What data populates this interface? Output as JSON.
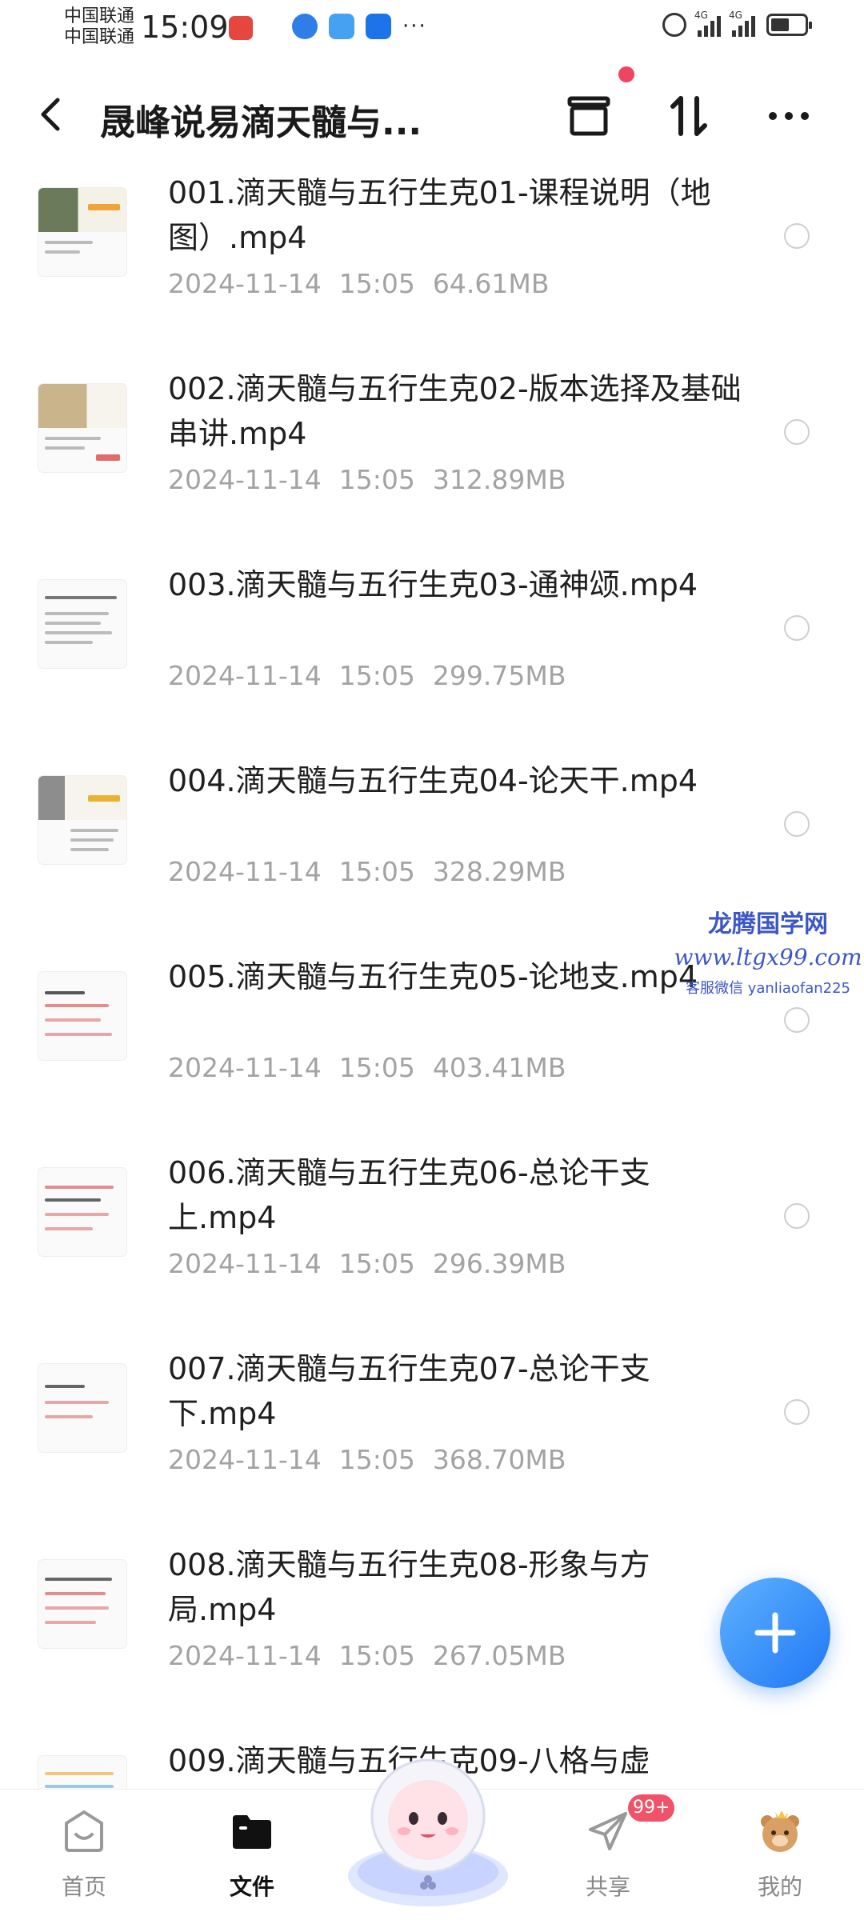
{
  "status_bar": {
    "carrier_1": "中国联通",
    "carrier_2": "中国联通",
    "time": "15:09",
    "more": "···",
    "network_1": "4G",
    "network_2": "4G"
  },
  "header": {
    "title": "晟峰说易滴天髓与...",
    "icons": [
      "back-icon",
      "archive-icon",
      "sort-icon",
      "more-icon"
    ]
  },
  "files": [
    {
      "name": "001.滴天髓与五行生克01-课程说明（地图）.mp4",
      "date": "2024-11-14",
      "time": "15:05",
      "size": "64.61MB"
    },
    {
      "name": "002.滴天髓与五行生克02-版本选择及基础串讲.mp4",
      "date": "2024-11-14",
      "time": "15:05",
      "size": "312.89MB"
    },
    {
      "name": "003.滴天髓与五行生克03-通神颂.mp4",
      "date": "2024-11-14",
      "time": "15:05",
      "size": "299.75MB"
    },
    {
      "name": "004.滴天髓与五行生克04-论天干.mp4",
      "date": "2024-11-14",
      "time": "15:05",
      "size": "328.29MB"
    },
    {
      "name": "005.滴天髓与五行生克05-论地支.mp4",
      "date": "2024-11-14",
      "time": "15:05",
      "size": "403.41MB"
    },
    {
      "name": "006.滴天髓与五行生克06-总论干支上.mp4",
      "date": "2024-11-14",
      "time": "15:05",
      "size": "296.39MB"
    },
    {
      "name": "007.滴天髓与五行生克07-总论干支下.mp4",
      "date": "2024-11-14",
      "time": "15:05",
      "size": "368.70MB"
    },
    {
      "name": "008.滴天髓与五行生克08-形象与方局.mp4",
      "date": "2024-11-14",
      "time": "15:05",
      "size": "267.05MB"
    },
    {
      "name": "009.滴天髓与五行生克09-八格与虚",
      "date": "",
      "time": "",
      "size": ""
    }
  ],
  "watermark": {
    "line1": "龙腾国学网",
    "line2": "www.ltgx99.com",
    "line3": "客服微信 yanliaofan225"
  },
  "bottom_nav": {
    "home": "首页",
    "files": "文件",
    "share": "共享",
    "mine": "我的",
    "share_badge": "99+"
  },
  "colors": {
    "accent": "#1f78f5",
    "badge": "#f25268",
    "meta_text": "#a3a3a3"
  }
}
